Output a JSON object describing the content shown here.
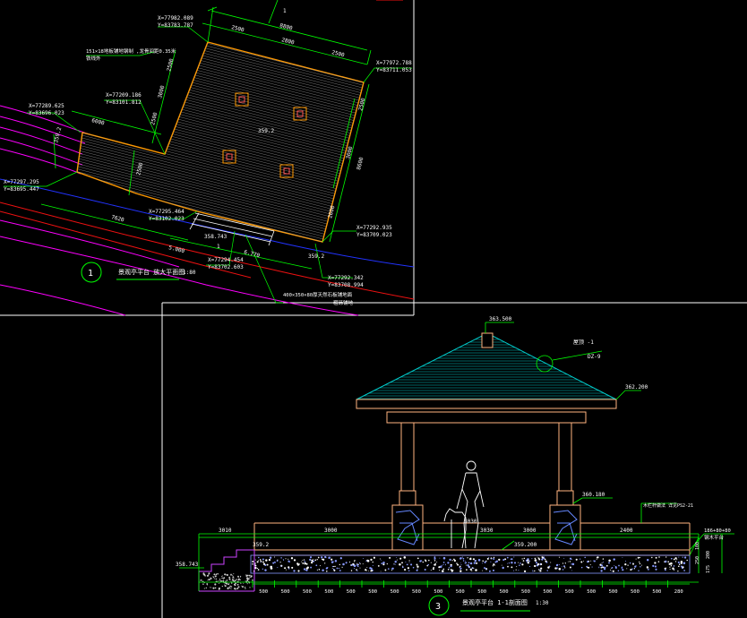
{
  "colors": {
    "background": "#000000",
    "frame": "#ffffff",
    "dimension": "#00ff00",
    "platform_outline": "#ff9900",
    "roof": "#00cccc",
    "column": "#ffb380",
    "road_blue": "#2233ff",
    "road_red": "#ee1111",
    "road_magenta": "#ff00ff",
    "stone": "#6688ff",
    "gravel": "#8899ff",
    "steps": "#cc44ff",
    "label": "#ffffff",
    "figure": "#ffffff"
  },
  "plan": {
    "callout_number": "1",
    "title": "景观亭平台 放大平面图",
    "scale": "1:80",
    "section_mark": "1",
    "note_top": "151×18地板铺地钢制 ,龙骨间距0.35米",
    "note_top2": "铁线外",
    "note_bottom": "400×350×80厚天然石板铺地面",
    "note_bottom2": "粗砾铺地",
    "coords": [
      {
        "x": "X=77982.089",
        "y": "Y=83783.787"
      },
      {
        "x": "X=77972.788",
        "y": "Y=83711.053"
      },
      {
        "x": "X=77209.186",
        "y": "Y=83101.812"
      },
      {
        "x": "X=77289.625",
        "y": "Y=83696.023"
      },
      {
        "x": "X=77297.295",
        "y": "Y=83695.447"
      },
      {
        "x": "X=77295.464",
        "y": "Y=83102.023"
      },
      {
        "x": "X=77294.454",
        "y": "Y=83702.603"
      },
      {
        "x": "X=77292.935",
        "y": "Y=83709.023"
      },
      {
        "x": "X=77292.342",
        "y": "Y=83708.994"
      }
    ],
    "elevations": [
      "359.2",
      "359.2",
      "358.743",
      "359.2"
    ],
    "dims_top": [
      "2500",
      "2800",
      "2500"
    ],
    "dims_total_top": "8800",
    "dims_left": [
      "2500",
      "3000",
      "2500"
    ],
    "dims_right": [
      "2500",
      "3000",
      "8600"
    ],
    "dims_other": [
      "6000",
      "2500",
      "7620",
      "5.000",
      "6.770",
      "2000"
    ]
  },
  "section": {
    "callout_number": "3",
    "title": "景观亭平台 1-1剖面图",
    "scale": "1:30",
    "ridge_elevation": "363.500",
    "eave_elevation": "362.200",
    "beam_elevation": "360.180",
    "floor_elevations": [
      "359.2",
      "359.200"
    ],
    "ground_elevation": "358.743",
    "roof_label": "屋顶 -1",
    "detail_ref": "DZ-9",
    "railing_note": "木栏杆做法 详见PS2-21",
    "right_note": "186+80+80",
    "right_note2": "钢木平台",
    "right_dims": [
      "100",
      "250",
      "200",
      "175"
    ],
    "span_dims": [
      "3010",
      "3000",
      "3030",
      "3000",
      "2400"
    ],
    "figure_label": "3030",
    "bottom_dims": [
      "500",
      "500",
      "500",
      "500",
      "500",
      "500",
      "500",
      "500",
      "500",
      "500",
      "500",
      "500",
      "500",
      "500",
      "500",
      "500",
      "500",
      "500",
      "500",
      "280"
    ]
  }
}
